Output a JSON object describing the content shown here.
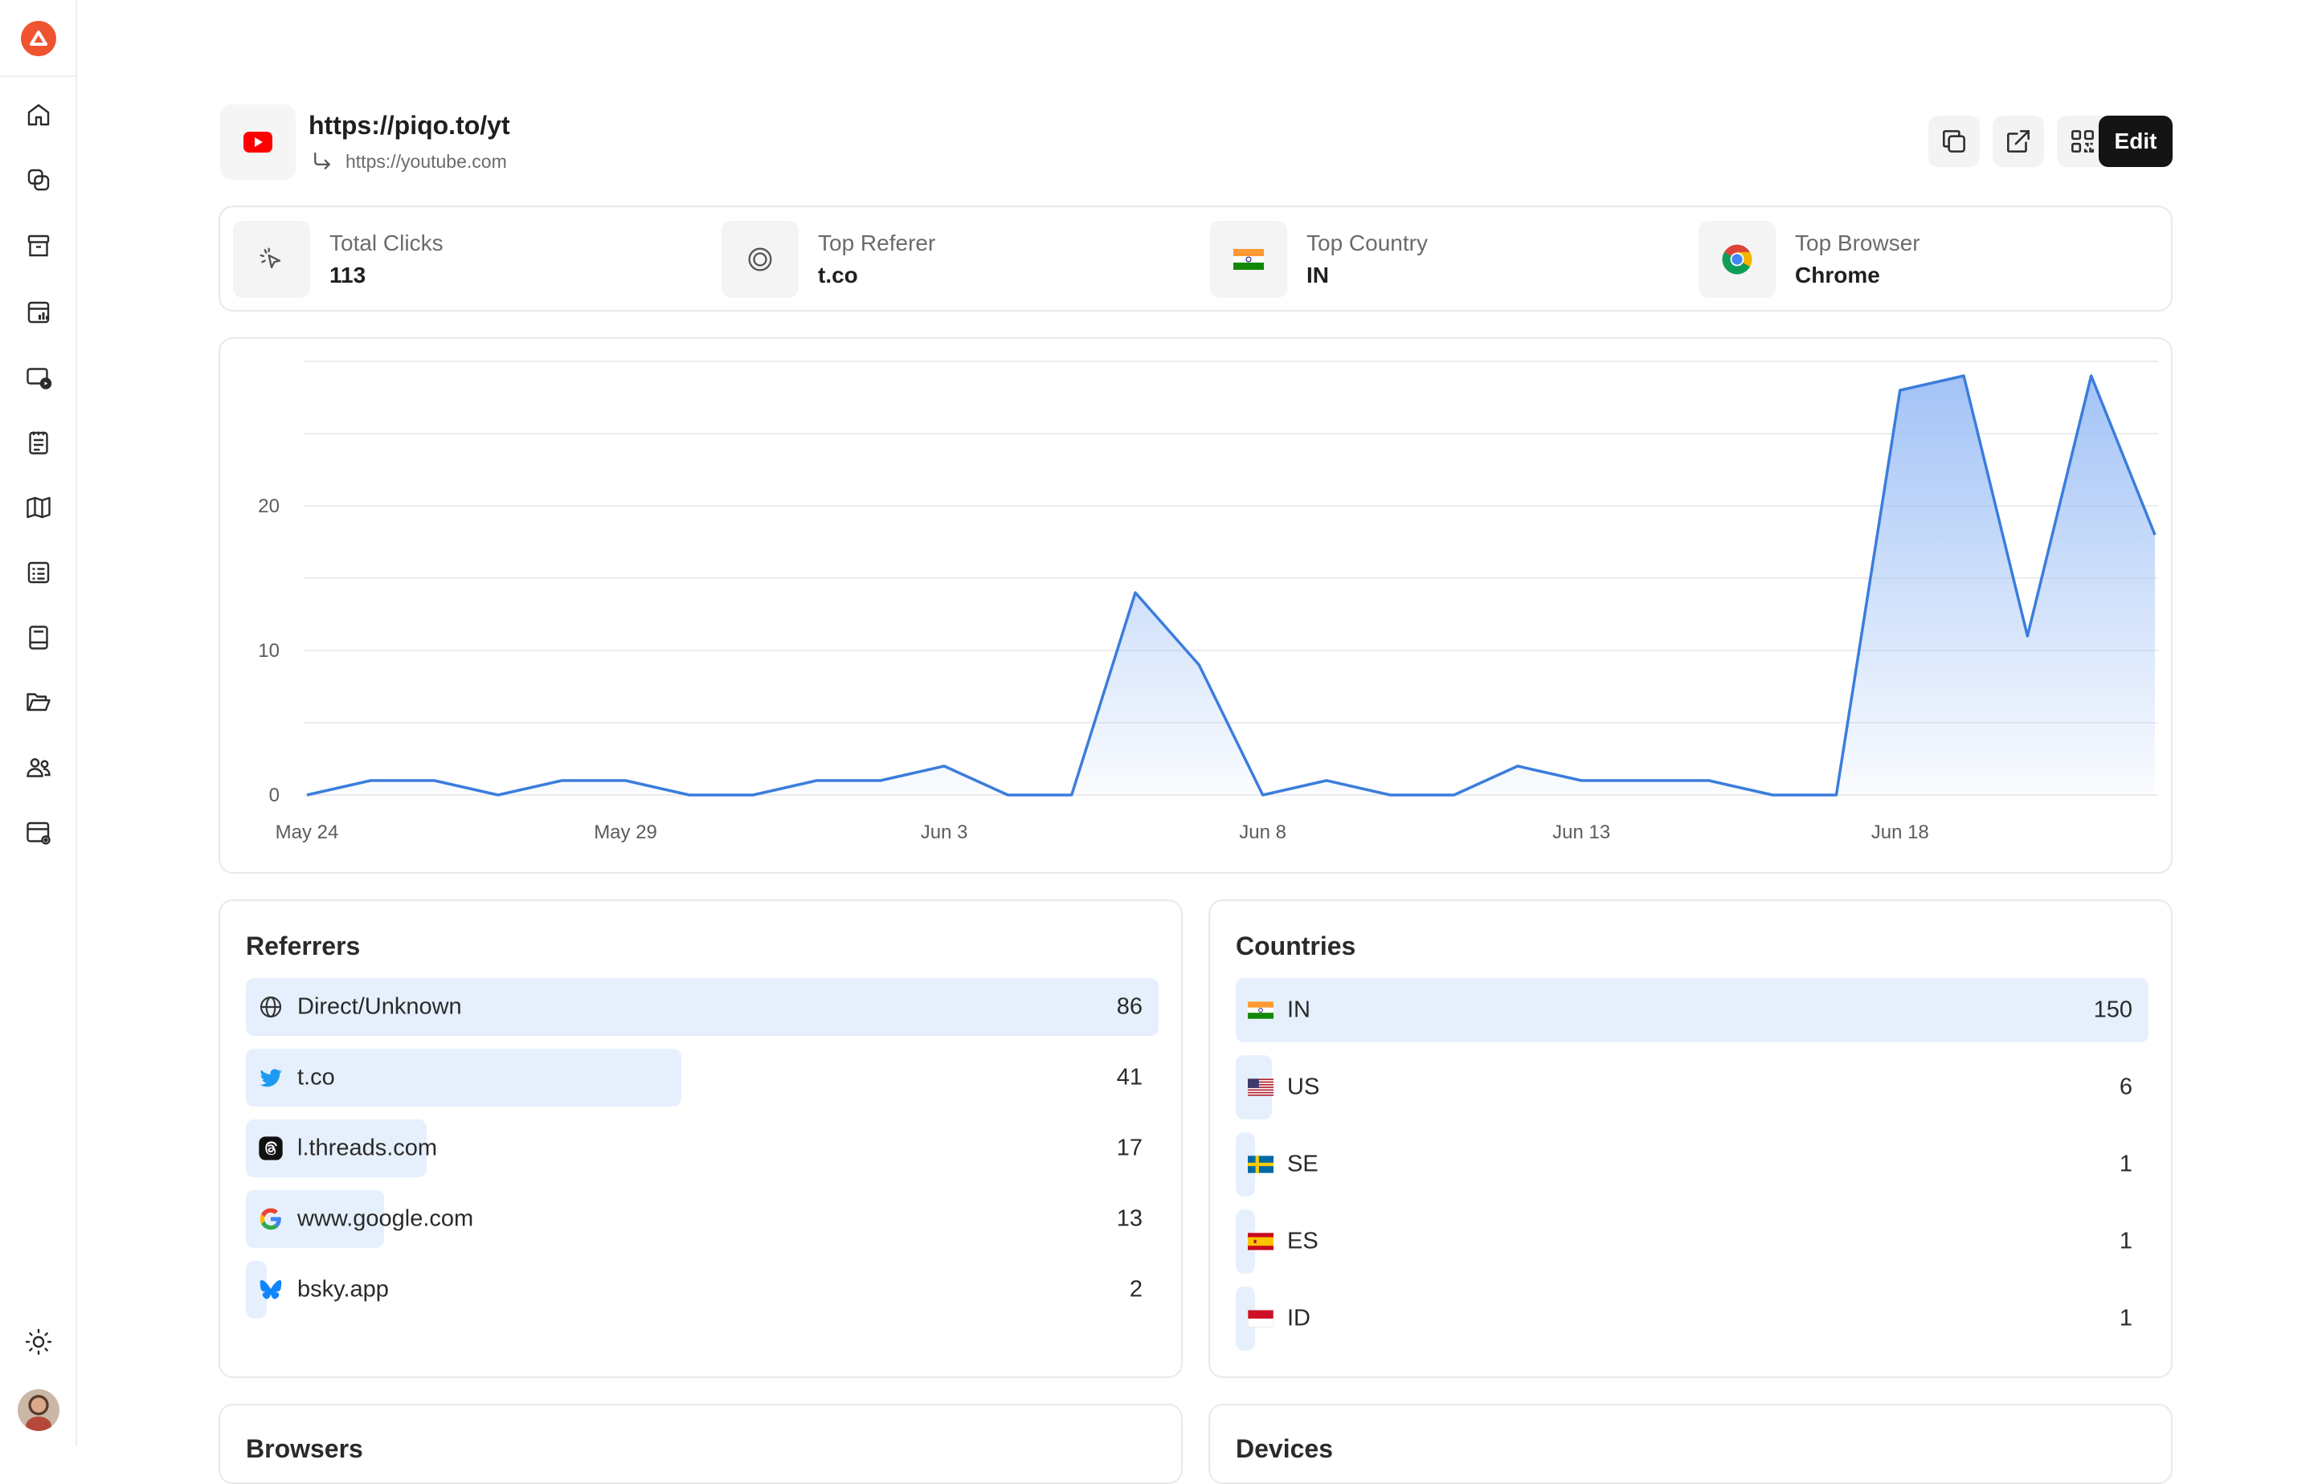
{
  "link": {
    "short_url": "https://piqo.to/yt",
    "destination": "https://youtube.com"
  },
  "toolbar": {
    "edit_label": "Edit"
  },
  "stats": [
    {
      "label": "Total Clicks",
      "value": "113"
    },
    {
      "label": "Top Referer",
      "value": "t.co"
    },
    {
      "label": "Top Country",
      "value": "IN"
    },
    {
      "label": "Top Browser",
      "value": "Chrome"
    }
  ],
  "chart_data": {
    "type": "area",
    "x_tick_labels": [
      "May 24",
      "May 29",
      "Jun 3",
      "Jun 8",
      "Jun 13",
      "Jun 18"
    ],
    "x": [
      "May 24",
      "May 25",
      "May 26",
      "May 27",
      "May 28",
      "May 29",
      "May 30",
      "May 31",
      "Jun 1",
      "Jun 2",
      "Jun 3",
      "Jun 4",
      "Jun 5",
      "Jun 6",
      "Jun 7",
      "Jun 8",
      "Jun 9",
      "Jun 10",
      "Jun 11",
      "Jun 12",
      "Jun 13",
      "Jun 14",
      "Jun 15",
      "Jun 16",
      "Jun 17",
      "Jun 18",
      "Jun 19",
      "Jun 20",
      "Jun 21",
      "Jun 22"
    ],
    "values": [
      0,
      1,
      1,
      0,
      1,
      1,
      0,
      0,
      1,
      1,
      2,
      0,
      0,
      14,
      9,
      0,
      1,
      0,
      0,
      2,
      1,
      1,
      1,
      0,
      0,
      28,
      29,
      11,
      29,
      18
    ],
    "y_ticks": [
      0,
      10,
      20
    ],
    "ylim": [
      0,
      30
    ],
    "grid": true,
    "line_color": "#3b7ddd",
    "fill_color": "#9ec0f6"
  },
  "referrers": {
    "title": "Referrers",
    "items": [
      {
        "label": "Direct/Unknown",
        "count": "86",
        "value": 86,
        "icon": "globe-icon"
      },
      {
        "label": "t.co",
        "count": "41",
        "value": 41,
        "icon": "twitter-icon"
      },
      {
        "label": "l.threads.com",
        "count": "17",
        "value": 17,
        "icon": "threads-icon"
      },
      {
        "label": "www.google.com",
        "count": "13",
        "value": 13,
        "icon": "google-icon"
      },
      {
        "label": "bsky.app",
        "count": "2",
        "value": 2,
        "icon": "bluesky-icon"
      }
    ]
  },
  "countries": {
    "title": "Countries",
    "items": [
      {
        "label": "IN",
        "count": "150",
        "value": 150,
        "icon": "flag-in-icon"
      },
      {
        "label": "US",
        "count": "6",
        "value": 6,
        "icon": "flag-us-icon"
      },
      {
        "label": "SE",
        "count": "1",
        "value": 1,
        "icon": "flag-se-icon"
      },
      {
        "label": "ES",
        "count": "1",
        "value": 1,
        "icon": "flag-es-icon"
      },
      {
        "label": "ID",
        "count": "1",
        "value": 1,
        "icon": "flag-id-icon"
      }
    ]
  },
  "peek_cards": [
    {
      "title": "Browsers"
    },
    {
      "title": "Devices"
    }
  ],
  "colors": {
    "accent": "#3b7ddd",
    "bar_fill": "#e6f0fd",
    "logo": "#f0532f"
  }
}
